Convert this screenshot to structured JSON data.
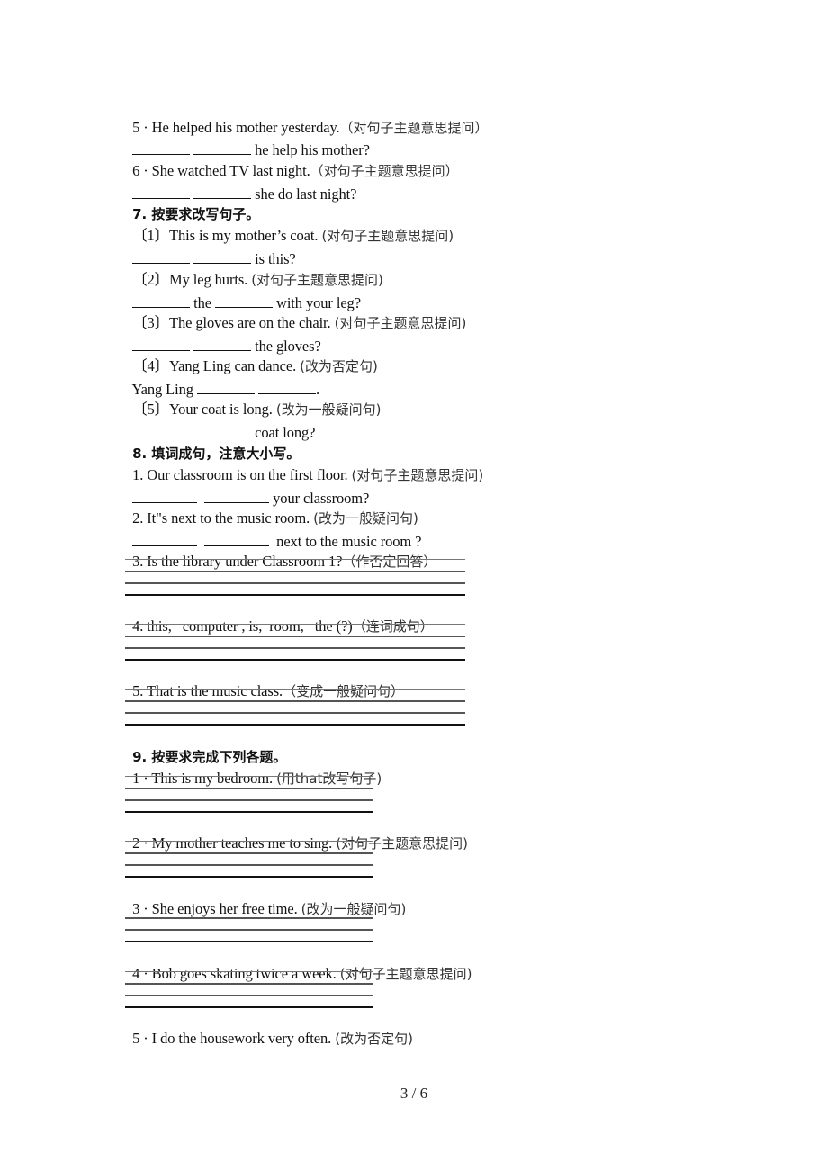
{
  "section6_tail": {
    "q5": {
      "prompt": "5 · He helped his mother yesterday.",
      "hint": "（对句子主题意思提问）",
      "answer_suffix": " he help his mother?"
    },
    "q6": {
      "prompt": "6 · She watched TV last night.",
      "hint": "（对句子主题意思提问）",
      "answer_suffix": " she do last night?"
    }
  },
  "section7": {
    "title": "7. 按要求改写句子。",
    "items": [
      {
        "prompt": "〔1〕This is my mother’s coat. ",
        "hint": "(对句子主题意思提问)",
        "answer_suffix": " is this?"
      },
      {
        "prompt": "〔2〕My leg hurts. ",
        "hint": "(对句子主题意思提问)",
        "answer_mid": " the ",
        "answer_suffix": " with your leg?"
      },
      {
        "prompt": "〔3〕The gloves are on the chair. ",
        "hint": "(对句子主题意思提问)",
        "answer_suffix": " the gloves?"
      },
      {
        "prompt": "〔4〕Yang Ling can dance. ",
        "hint": "(改为否定句)",
        "answer_prefix": "Yang Ling ",
        "answer_suffix": "."
      },
      {
        "prompt": "〔5〕Your coat is long. ",
        "hint": "(改为一般疑问句)",
        "answer_suffix": " coat long?"
      }
    ]
  },
  "section8": {
    "title": "8. 填词成句，注意大小写。",
    "items": [
      {
        "prompt": "1. Our classroom is on the first floor. ",
        "hint": "(对句子主题意思提问)",
        "answer_suffix": " your classroom?"
      },
      {
        "prompt": "2. It\"s next to the music room. ",
        "hint": "(改为一般疑问句)",
        "answer_suffix": "  next to the music room ?"
      },
      {
        "prompt": "3. Is the library under Classroom 1?",
        "hint": "（作否定回答）"
      },
      {
        "prompt": "4. this,   computer , is,  room,   the (?)",
        "hint": "（连词成句）"
      },
      {
        "prompt": "5. That is the music class.",
        "hint": "（变成一般疑问句）"
      }
    ]
  },
  "section9": {
    "title": "9. 按要求完成下列各题。",
    "items": [
      {
        "prompt": "1 · This is my bedroom. ",
        "hint": "(用that改写句子)"
      },
      {
        "prompt": "2 · My mother teaches me to sing. ",
        "hint": "(对句子主题意思提问)"
      },
      {
        "prompt": "3 · She enjoys her free time. ",
        "hint": "(改为一般疑问句)"
      },
      {
        "prompt": "4 · Bob goes skating twice a week. ",
        "hint": "(对句子主题意思提问)"
      },
      {
        "prompt": "5 · I do the housework very often. ",
        "hint": "(改为否定句)"
      }
    ]
  },
  "footer": {
    "page_indicator": "3 / 6"
  }
}
